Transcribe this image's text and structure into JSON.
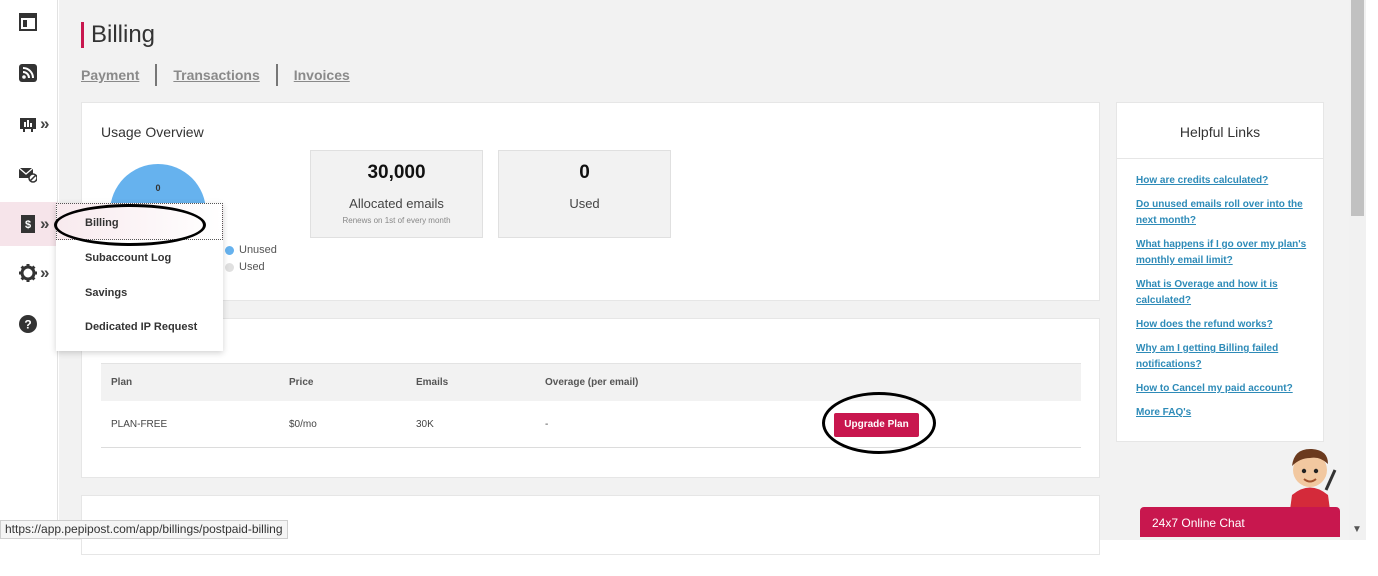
{
  "page": {
    "title": "Billing",
    "tabs": [
      {
        "label": "Payment"
      },
      {
        "label": "Transactions"
      },
      {
        "label": "Invoices"
      }
    ]
  },
  "nav": {
    "items": [
      {
        "icon": "dashboard-icon"
      },
      {
        "icon": "rss-icon"
      },
      {
        "icon": "reports-icon"
      },
      {
        "icon": "mail-settings-icon"
      },
      {
        "icon": "billing-icon"
      },
      {
        "icon": "gear-icon"
      },
      {
        "icon": "help-icon"
      }
    ],
    "submenu": [
      {
        "label": "Billing"
      },
      {
        "label": "Subaccount Log"
      },
      {
        "label": "Savings"
      },
      {
        "label": "Dedicated IP Request"
      }
    ]
  },
  "usage": {
    "title": "Usage Overview",
    "donut_value": "0",
    "legend": [
      {
        "label": "Unused",
        "color": "#66b2ee"
      },
      {
        "label": "Used",
        "color": "#e0e0e0"
      }
    ],
    "allocated": {
      "value": "30,000",
      "label": "Allocated emails",
      "note": "Renews on 1st of every month"
    },
    "used": {
      "value": "0",
      "label": "Used"
    }
  },
  "plan_table": {
    "headers": [
      "Plan",
      "Price",
      "Emails",
      "Overage (per email)"
    ],
    "rows": [
      {
        "plan": "PLAN-FREE",
        "price": "$0/mo",
        "emails": "30K",
        "overage": "-"
      }
    ],
    "upgrade_label": "Upgrade Plan"
  },
  "helpful_links": {
    "title": "Helpful Links",
    "links": [
      "How are credits calculated?",
      "Do unused emails roll over into the next month?",
      "What happens if I go over my plan's monthly email limit?",
      "What is Overage and how it is calculated?",
      "How does the refund works?",
      "Why am I getting Billing failed notifications?",
      "How to Cancel my paid account?",
      "More FAQ's"
    ]
  },
  "chat": {
    "label": "24x7 Online Chat"
  },
  "status_bar": {
    "url": "https://app.pepipost.com/app/billings/postpaid-billing"
  },
  "colors": {
    "accent": "#c8174e",
    "link": "#2e8bb8",
    "donut": "#66b2ee"
  }
}
